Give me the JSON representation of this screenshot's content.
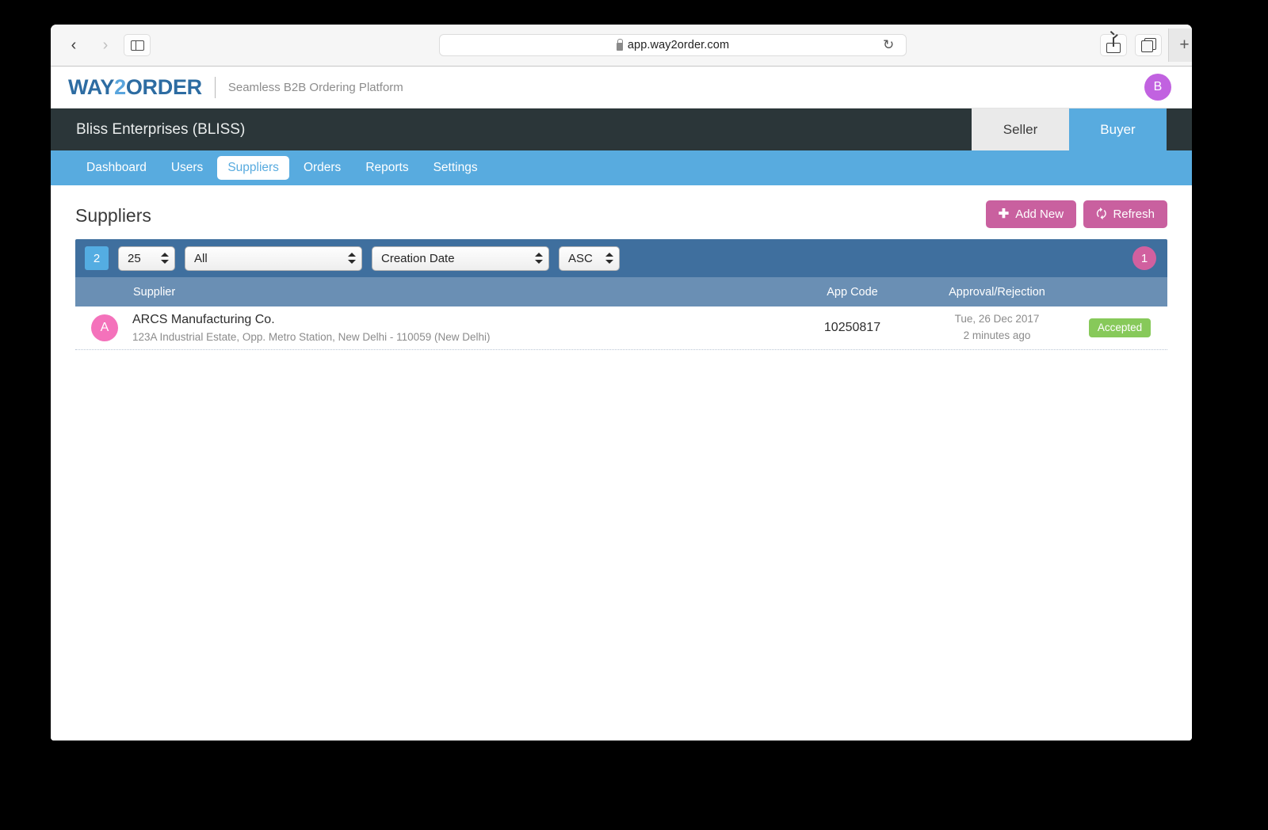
{
  "browser": {
    "back_icon": "‹",
    "forward_icon": "›",
    "sidebar_icon": "sidebar-icon",
    "url": "app.way2order.com",
    "reload_icon": "↻",
    "share_icon": "share-icon",
    "tabs_icon": "tabs-icon",
    "newtab_label": "+"
  },
  "brand": {
    "logo_prefix": "WAY",
    "logo_two": "2",
    "logo_suffix": "ORDER",
    "tagline": "Seamless B2B Ordering Platform",
    "avatar_initial": "B",
    "avatar_color": "#c162e0",
    "logo_color": "#2d6ca2",
    "logo_accent_color": "#59a5dd"
  },
  "org_bar": {
    "org_name": "Bliss Enterprises (BLISS)",
    "roles": [
      {
        "label": "Seller",
        "active": false
      },
      {
        "label": "Buyer",
        "active": true
      }
    ],
    "background": "#2b3639",
    "active_color": "#58abdf"
  },
  "nav": {
    "items": [
      {
        "label": "Dashboard",
        "active": false
      },
      {
        "label": "Users",
        "active": false
      },
      {
        "label": "Suppliers",
        "active": true
      },
      {
        "label": "Orders",
        "active": false
      },
      {
        "label": "Reports",
        "active": false
      },
      {
        "label": "Settings",
        "active": false
      }
    ],
    "background": "#58abdf"
  },
  "page": {
    "title": "Suppliers",
    "actions": [
      {
        "label": "Add New",
        "icon": "plus-icon"
      },
      {
        "label": "Refresh",
        "icon": "refresh-icon"
      }
    ],
    "action_color": "#c9609f"
  },
  "filters": {
    "count_badge": "2",
    "page_size": "25",
    "status_filter": "All",
    "sort_field": "Creation Date",
    "sort_direction": "ASC",
    "result_badge": "1",
    "bar_color": "#3f6f9e"
  },
  "table": {
    "headers": {
      "supplier": "Supplier",
      "app_code": "App Code",
      "approval": "Approval/Rejection",
      "status": ""
    },
    "header_color": "#6a8fb4",
    "rows": [
      {
        "avatar_initial": "A",
        "avatar_color": "#f472bb",
        "name": "ARCS Manufacturing Co.",
        "address": "123A Industrial Estate, Opp. Metro Station, New Delhi - 110059 (New Delhi)",
        "app_code": "10250817",
        "approval_date": "Tue, 26 Dec 2017",
        "approval_relative": "2 minutes ago",
        "status": "Accepted",
        "status_color": "#87c95a"
      }
    ]
  }
}
